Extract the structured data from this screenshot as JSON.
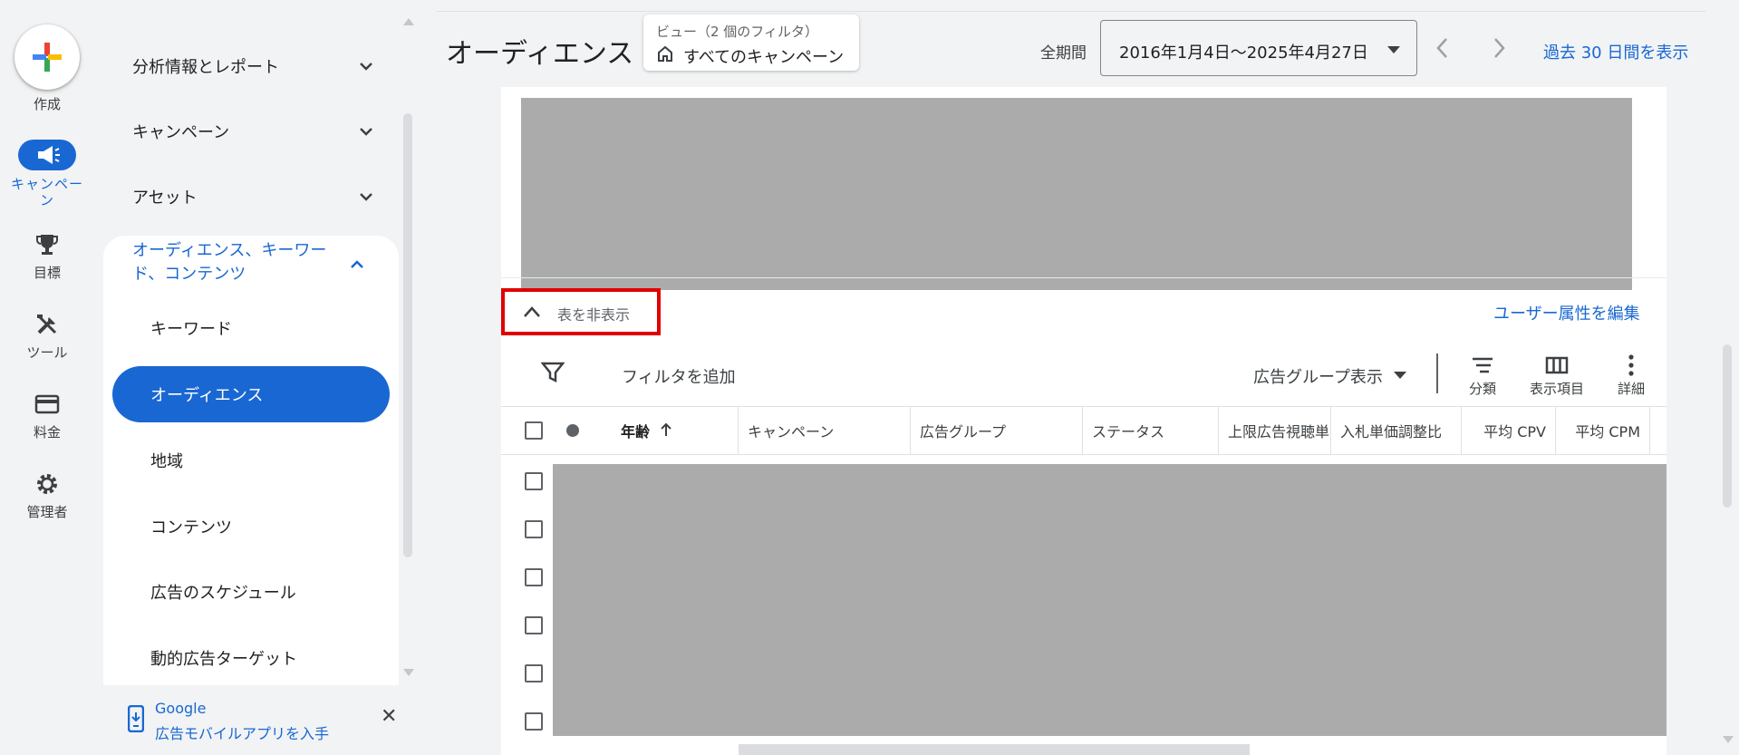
{
  "rail": {
    "create_label": "作成",
    "campaign_label": "キャンペーン",
    "goals_label": "目標",
    "tools_label": "ツール",
    "billing_label": "料金",
    "admin_label": "管理者"
  },
  "sidebar": {
    "sections": [
      {
        "label": "分析情報とレポート"
      },
      {
        "label": "キャンペーン"
      },
      {
        "label": "アセット"
      }
    ],
    "group_title": "オーディエンス、キーワード、コンテンツ",
    "sub_items": [
      {
        "label": "キーワード"
      },
      {
        "label": "オーディエンス"
      },
      {
        "label": "地域"
      },
      {
        "label": "コンテンツ"
      },
      {
        "label": "広告のスケジュール"
      },
      {
        "label": "動的広告ターゲット"
      }
    ],
    "promo_line1": "Google",
    "promo_line2": "広告モバイルアプリを入手"
  },
  "header": {
    "title": "オーディエンス",
    "view_caption": "ビュー（2 個のフィルタ）",
    "view_value": "すべてのキャンペーン",
    "period_label": "全期間",
    "date_range": "2016年1月4日～2025年4月27日",
    "last30": "過去 30 日間を表示"
  },
  "content": {
    "hide_table": "表を非表示",
    "edit_demographics": "ユーザー属性を編集",
    "add_filter": "フィルタを追加",
    "adgroup_view": "広告グループ表示",
    "tools": {
      "segment": "分類",
      "columns": "表示項目",
      "details": "詳細"
    },
    "columns": [
      "年齢",
      "キャンペーン",
      "広告グループ",
      "ステータス",
      "上限広告視聴単",
      "入札単価調整比",
      "平均 CPV",
      "平均 CPM"
    ],
    "row_count": 6
  },
  "colors": {
    "accent": "#1967d2",
    "highlight_border": "#e00000",
    "redacted": "#ababab"
  }
}
